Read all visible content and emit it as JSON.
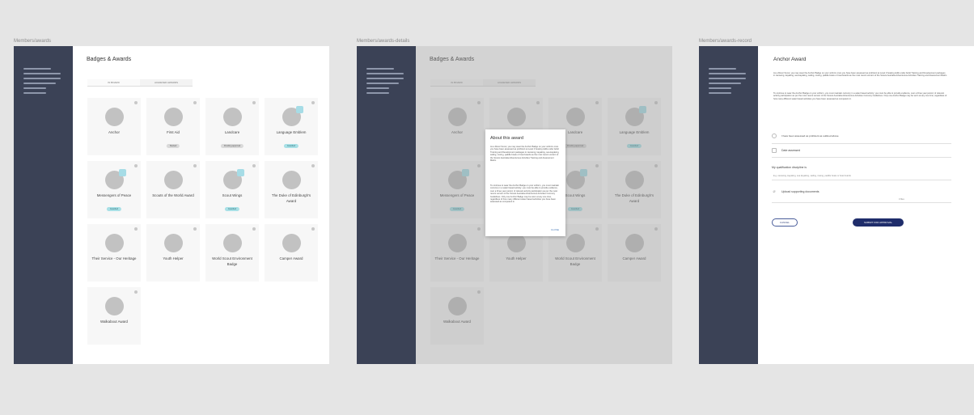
{
  "frames": {
    "list_label": "Members/awards",
    "details_label": "Members/awards-details",
    "record_label": "Members/awards-record"
  },
  "page": {
    "title": "Badges & Awards",
    "tab_in_progress": "IN BOARD",
    "tab_achieved": "ACHIEVED AWARDS"
  },
  "badges": [
    {
      "name": "Anchor",
      "status": "",
      "checked": false
    },
    {
      "name": "First Aid",
      "status": "Started",
      "checked": false
    },
    {
      "name": "Landcare",
      "status": "Pending approval",
      "checked": false
    },
    {
      "name": "Language Emblem",
      "status": "Awarded",
      "checked": true
    },
    {
      "name": "Messengers of Peace",
      "status": "Awarded",
      "checked": true
    },
    {
      "name": "Scouts of the World Award",
      "status": "",
      "checked": false
    },
    {
      "name": "Scout Wings",
      "status": "Awarded",
      "checked": true
    },
    {
      "name": "The Duke of Edinburgh's Award",
      "status": "",
      "checked": false
    },
    {
      "name": "Their Service - Our Heritage",
      "status": "",
      "checked": false
    },
    {
      "name": "Youth Helper",
      "status": "",
      "checked": false
    },
    {
      "name": "World Scout Environment Badge",
      "status": "",
      "checked": false
    },
    {
      "name": "Camper Award",
      "status": "",
      "checked": false
    },
    {
      "name": "Walkabout Award",
      "status": "",
      "checked": false
    }
  ],
  "modal": {
    "title": "About this award",
    "para1": "As a Rover Scout, you may wear the Anchor Badge on your uniform once you have been assessed as proficient at Level 3 boating skills under Adult Training and Development packages in canoeing, kayaking, sea kayaking, sailing, rowing, paddle boats or boat boards as the most recent version of the Scouts Australia Adventurous Activities Training and Assessment Matrix.",
    "para2": "To continue to wear the Anchor Badge on your uniform, you must maintain currency in a water based activity; you must be able to provide evidence, over a three year period, of relevant activity participation as per the most recent version of the Scouts Australia Adventurous Activities Currency Guidelines. Only one Anchor Badge may be worn at any one time, regardless of how many different water based activities you have been assessed as competent in.",
    "close": "CLOSE"
  },
  "record": {
    "title": "Anchor Award",
    "para1": "As a Rover Scout, you may wear the Anchor Badge on your uniform once you have been assessed as proficient at Level 3 boating skills under Adult Training and Development packages in canoeing, kayaking, sea kayaking, sailing, rowing, paddle boats or boat boards as the most recent version of the Scouts Australia Adventurous Activities Training and Assessment Matrix.",
    "para2": "To continue to wear the Anchor Badge on your uniform, you must maintain currency in a water based activity; you must be able to provide evidence, over a three year period, of relevant activity participation as per the most recent version of the Scouts Australia Adventurous Activities Currency Guidelines. Only one Anchor Badge may be worn at any one time, regardless of how many different water based activities you have been assessed as competent in.",
    "checkbox_label": "I have been assessed as proficient as outlined above",
    "date_label": "Date assessed",
    "qualification_label": "My qualification discipline is",
    "qualification_hint": "E.g. canoeing, kayaking, sea kayaking, sailing, rowing, paddle boats or boat boards",
    "upload_label": "Upload supporting documents",
    "upload_meta": "0 files",
    "cancel": "CANCEL",
    "submit": "SUBMIT FOR APPROVAL"
  }
}
